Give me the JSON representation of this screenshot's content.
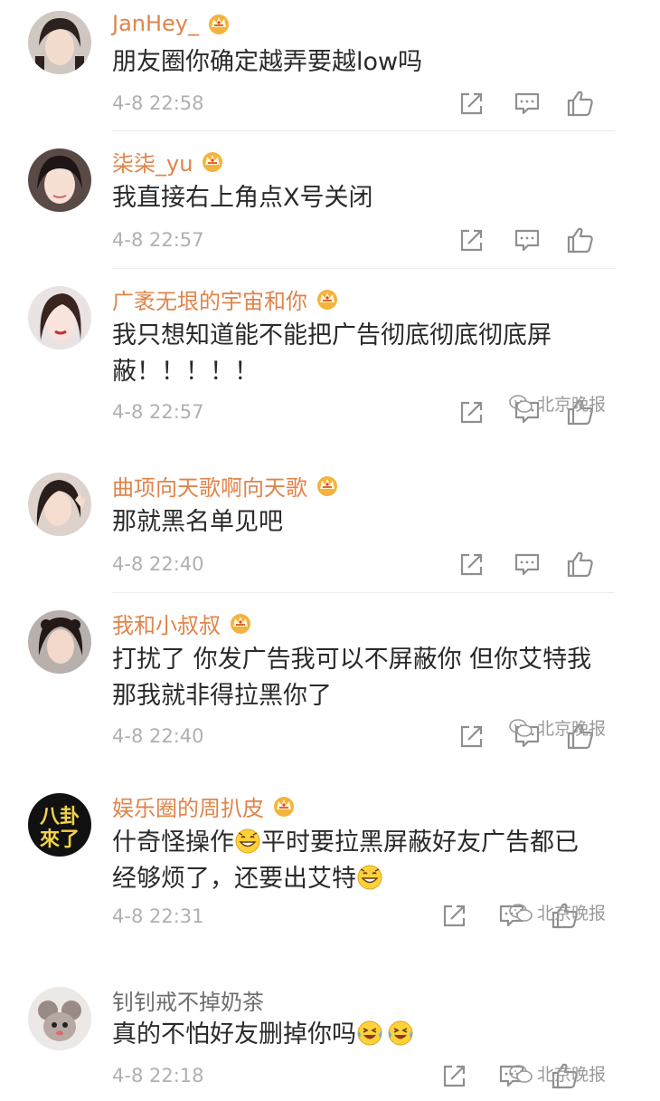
{
  "comments": [
    {
      "name": "JanHey_",
      "text1": "朋友圈你确定越弄要越low吗",
      "text2": "",
      "time": "4-8 22:58",
      "vip": true
    },
    {
      "name": "柒柒_yu",
      "text1": "我直接右上角点X号关闭",
      "text2": "",
      "time": "4-8 22:57",
      "vip": true
    },
    {
      "name": "广袤无垠的宇宙和你",
      "text1": "我只想知道能不能把广告彻底彻底彻底屏",
      "text2": "蔽！！！！！",
      "time": "4-8 22:57",
      "vip": true
    },
    {
      "name": "曲项向天歌啊向天歌",
      "text1": "那就黑名单见吧",
      "text2": "",
      "time": "4-8 22:40",
      "vip": true
    },
    {
      "name": "我和小叔叔",
      "text1": "打扰了 你发广告我可以不屏蔽你 但你艾特我",
      "text2": "那我就非得拉黑你了",
      "time": "4-8 22:40",
      "vip": true
    },
    {
      "name": "娱乐圈的周扒皮",
      "text1a": "什奇怪操作",
      "text1b": "平时要拉黑屏蔽好友广告都已",
      "text2": "经够烦了，还要出艾特",
      "time": "4-8 22:31",
      "vip": true,
      "avatar_text1": "八卦",
      "avatar_text2": "來了"
    },
    {
      "name": "钊钊戒不掉奶茶",
      "text1": "真的不怕好友删掉你吗",
      "text2": "",
      "time": "4-8 22:18",
      "vip": false
    }
  ],
  "watermark": "北京晚报",
  "icons": {
    "share": "share-icon",
    "comment": "comment-icon",
    "like": "like-icon",
    "vip": "crown-icon"
  },
  "colors": {
    "name": "#e0844a",
    "name_plain": "#6d6d6d",
    "time": "#b0b0b0",
    "text": "#2a2a2a"
  }
}
